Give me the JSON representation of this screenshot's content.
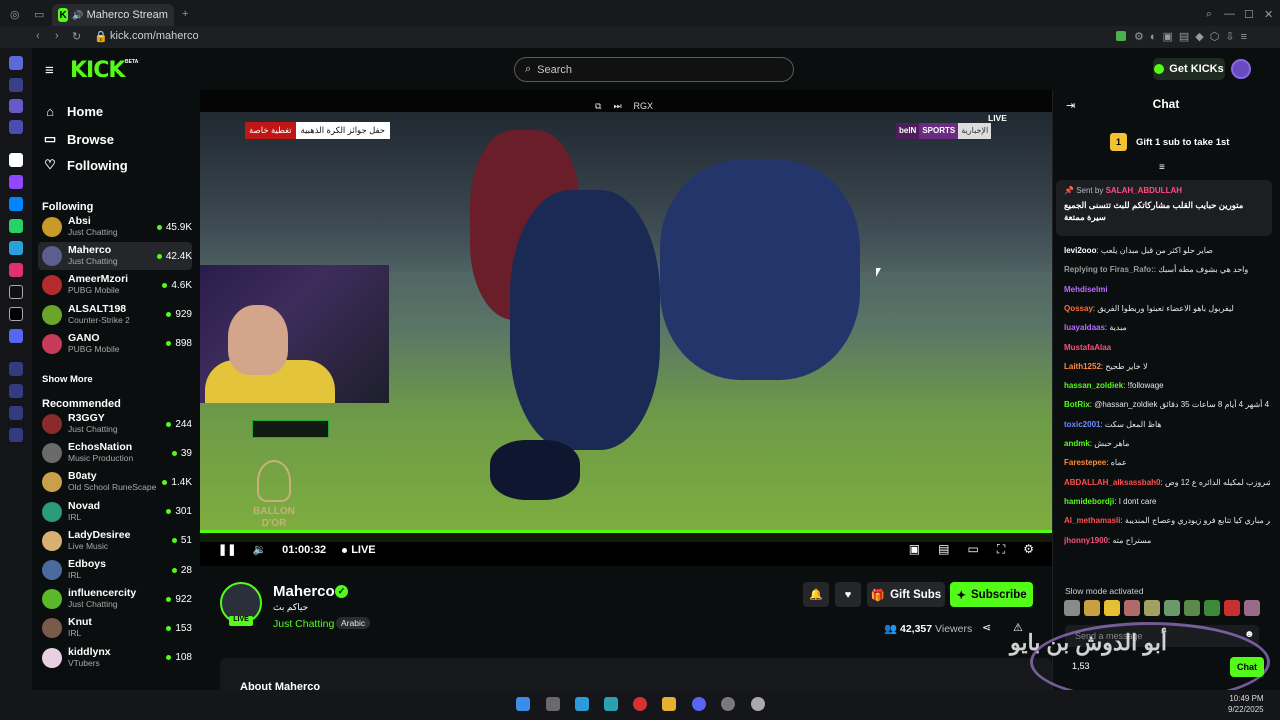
{
  "browser": {
    "tab_title": "Maherco Stream - Wat",
    "url": "kick.com/maherco"
  },
  "header": {
    "logo": "KICK",
    "beta": "BETA",
    "search_placeholder": "Search",
    "get_kicks": "Get KICKs"
  },
  "nav": {
    "home": "Home",
    "browse": "Browse",
    "following": "Following"
  },
  "following_section": {
    "title": "Following",
    "channels": [
      {
        "name": "Absi",
        "category": "Just Chatting",
        "viewers": "45.9K",
        "color": "#c89a2a"
      },
      {
        "name": "Maherco",
        "category": "Just Chatting",
        "viewers": "42.4K",
        "color": "#5a5f8c"
      },
      {
        "name": "AmeerMzori",
        "category": "PUBG Mobile",
        "viewers": "4.6K",
        "color": "#b52a2a"
      },
      {
        "name": "ALSALT198",
        "category": "Counter-Strike 2",
        "viewers": "929",
        "color": "#6aa52a"
      },
      {
        "name": "GANO",
        "category": "PUBG Mobile",
        "viewers": "898",
        "color": "#c83a5a"
      }
    ],
    "show_more": "Show More"
  },
  "recommended_section": {
    "title": "Recommended",
    "channels": [
      {
        "name": "R3GGY",
        "category": "Just Chatting",
        "viewers": "244",
        "color": "#8a2a2a"
      },
      {
        "name": "EchosNation",
        "category": "Music Production",
        "viewers": "39",
        "color": "#6a6a6a"
      },
      {
        "name": "B0aty",
        "category": "Old School RuneScape",
        "viewers": "1.4K",
        "color": "#c8a04a"
      },
      {
        "name": "Novad",
        "category": "IRL",
        "viewers": "301",
        "color": "#2a9a7a"
      },
      {
        "name": "LadyDesiree",
        "category": "Live Music",
        "viewers": "51",
        "color": "#d8b070"
      },
      {
        "name": "Edboys",
        "category": "IRL",
        "viewers": "28",
        "color": "#4a6aa0"
      },
      {
        "name": "influencercity",
        "category": "Just Chatting",
        "viewers": "922",
        "color": "#5ab82a"
      },
      {
        "name": "Knut",
        "category": "IRL",
        "viewers": "153",
        "color": "#7a5a4a"
      },
      {
        "name": "kiddlynx",
        "category": "VTubers",
        "viewers": "108",
        "color": "#e8d0e0"
      }
    ]
  },
  "player": {
    "top_badge": "RGX",
    "live_label": "LIVE",
    "bein_a": "beIN",
    "bein_b": "SPORTS",
    "bein_c": "الإخبارية",
    "tag_red": "تغطية خاصة",
    "tag_white": "حفل جوائز الكرة الذهبية",
    "ballon_text": "BALLON\nD'OR",
    "progress": 1.0,
    "time": "01:00:32",
    "live": "LIVE"
  },
  "channel": {
    "name": "Maherco",
    "subtitle": "حياكم بث",
    "category": "Just Chatting",
    "language": "Arabic",
    "live_pill": "LIVE",
    "gift_subs": "Gift Subs",
    "subscribe": "Subscribe",
    "viewers": "42,357",
    "viewers_label": "Viewers",
    "about": "About Maherco"
  },
  "chat": {
    "title": "Chat",
    "gift_rank": "1",
    "gift_text": "Gift 1 sub to take 1st",
    "pinned_sent_by": "Sent by",
    "pinned_user": "SALAH_ABDULLAH",
    "pinned_msg": "متورين حبايب القلب مشاركاتكم للبث تتسنى الجميع سيرة ممتعة",
    "messages": [
      {
        "user": "levi2ooo",
        "text": "صاير حلو اكثر من قبل مبدان يلعب",
        "color": "#ffffff"
      },
      {
        "user": "Replying to Firas_Rafo:",
        "text": "واحد هي بشوف مطه أسبك",
        "color": "#9a9a9a"
      },
      {
        "user": "Mehdiselmi",
        "text": "",
        "color": "#b96bff"
      },
      {
        "user": "Qossay",
        "text": "ليفربول باهو الاعضاء تعبتوا وربطوا الفريق",
        "color": "#ff6b3a"
      },
      {
        "user": "luayaldaas",
        "text": "مبدية",
        "color": "#b96bff"
      },
      {
        "user": "MustafaAlaa",
        "text": "",
        "color": "#ff4f7b"
      },
      {
        "user": "Laith1252",
        "text": "لا خاير طحيح",
        "color": "#ff8a3a"
      },
      {
        "user": "hassan_zoldiek",
        "text": "!followage",
        "color": "#53fc18"
      },
      {
        "user": "BotRix",
        "text": "@hassan_zoldiek يتابع هذه القناة لـ 1 سنوات 4 أشهر 4 أيام 8 ساعات 35 دقائق",
        "color": "#53fc18"
      },
      {
        "user": "toxic2001",
        "text": "هاظ المعل سكت",
        "color": "#6b8cff"
      },
      {
        "user": "andmk",
        "text": "ماهر حبش",
        "color": "#53fc18"
      },
      {
        "user": "Farestepee",
        "text": "عماه",
        "color": "#ff8a3a"
      },
      {
        "user": "ABDALLAH_alksassbah0",
        "text": "ي مشروزب لمكيله الدائره ع 12 وص",
        "color": "#ff4f4f"
      },
      {
        "user": "hamidebordji",
        "text": "I dont care",
        "color": "#53fc18"
      },
      {
        "user": "Al_methamasli",
        "text": "ياااه متصير الحياه بذاكر مباري كيا تتابع فرو زيودري وعصاج المنديبة",
        "color": "#ff4f4f"
      },
      {
        "user": "jhonny1900",
        "text": "مستراح مته",
        "color": "#ff4f7b"
      }
    ],
    "slow_mode": "Slow mode activated",
    "input_placeholder": "Send a message",
    "send": "Chat",
    "watermark": "أبو الدوش بن بايو",
    "count": "1,53"
  },
  "taskbar": {
    "time": "10:49 PM",
    "date": "9/22/2025"
  }
}
